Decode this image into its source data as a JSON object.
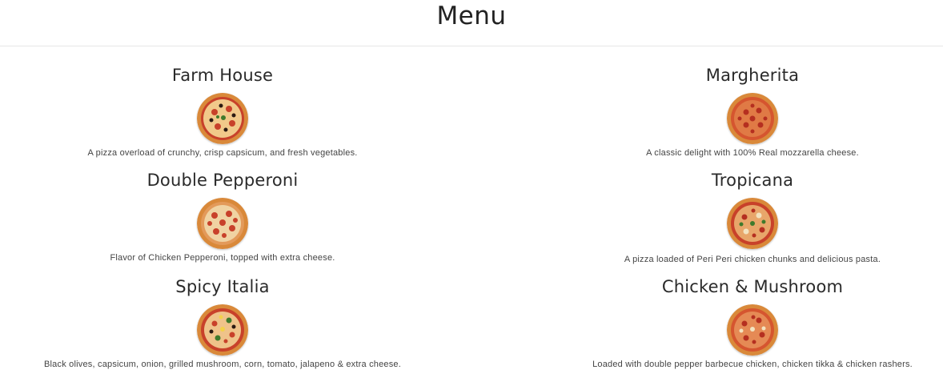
{
  "header": {
    "title": "Menu"
  },
  "menu": {
    "items": [
      {
        "name": "Farm House",
        "description": "A pizza overload of crunchy, crisp capsicum, and fresh vegetables.",
        "image_icon": "pizza-farm-house-icon"
      },
      {
        "name": "Margherita",
        "description": "A classic delight with 100% Real mozzarella cheese.",
        "image_icon": "pizza-margherita-icon"
      },
      {
        "name": "Double Pepperoni",
        "description": "Flavor of Chicken Pepperoni, topped with extra cheese.",
        "image_icon": "pizza-double-pepperoni-icon"
      },
      {
        "name": "Tropicana",
        "description": "A pizza loaded of Peri Peri chicken chunks and delicious pasta.",
        "image_icon": "pizza-tropicana-icon"
      },
      {
        "name": "Spicy Italia",
        "description": "Black olives, capsicum, onion, grilled mushroom, corn, tomato, jalapeno & extra cheese.",
        "image_icon": "pizza-spicy-italia-icon"
      },
      {
        "name": "Chicken & Mushroom",
        "description": "Loaded with double pepper barbecue chicken, chicken tikka & chicken rashers.",
        "image_icon": "pizza-chicken-mushroom-icon"
      }
    ]
  },
  "colors": {
    "crust": "#d9893a",
    "sauce": "#c8412a",
    "cheese": "#f1c98a",
    "topping_dark": "#2b1a12",
    "topping_green": "#3f7a2c"
  }
}
